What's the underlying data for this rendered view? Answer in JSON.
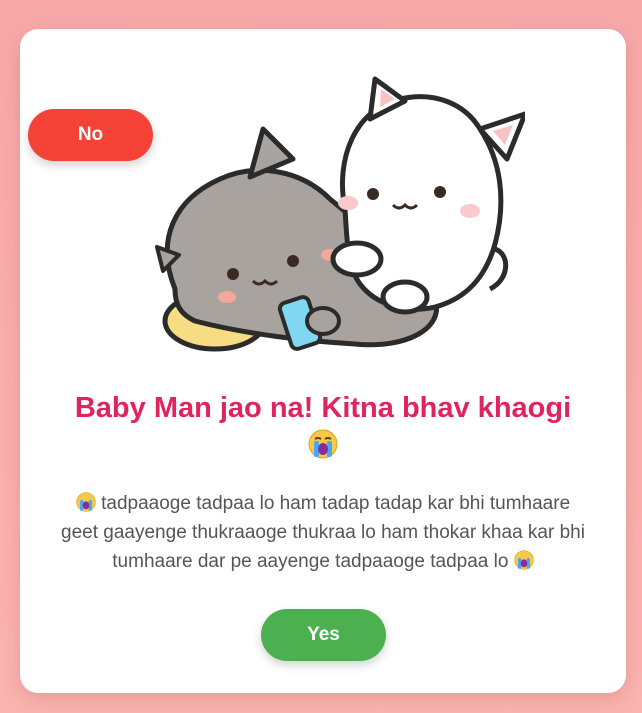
{
  "card": {
    "title": "Baby Man jao na! Kitna bhav khaogi",
    "title_emoji": "loudly-crying-face-icon",
    "message_prefix_emoji": "loudly-crying-face-icon",
    "message": "tadpaaoge tadpaa lo ham tadap tadap kar bhi tumhaare geet gaayenge thukraaoge thukraa lo ham thokar khaa kar bhi tumhaare dar pe aayenge tadpaaoge tadpaa lo",
    "message_suffix_emoji": "loudly-crying-face-icon",
    "illustration": "two-cats-sticker"
  },
  "buttons": {
    "yes_label": "Yes",
    "no_label": "No"
  },
  "colors": {
    "background": "#f7a8a8",
    "title": "#e0245e",
    "yes": "#4caf50",
    "no": "#f44336",
    "text": "#555555"
  }
}
